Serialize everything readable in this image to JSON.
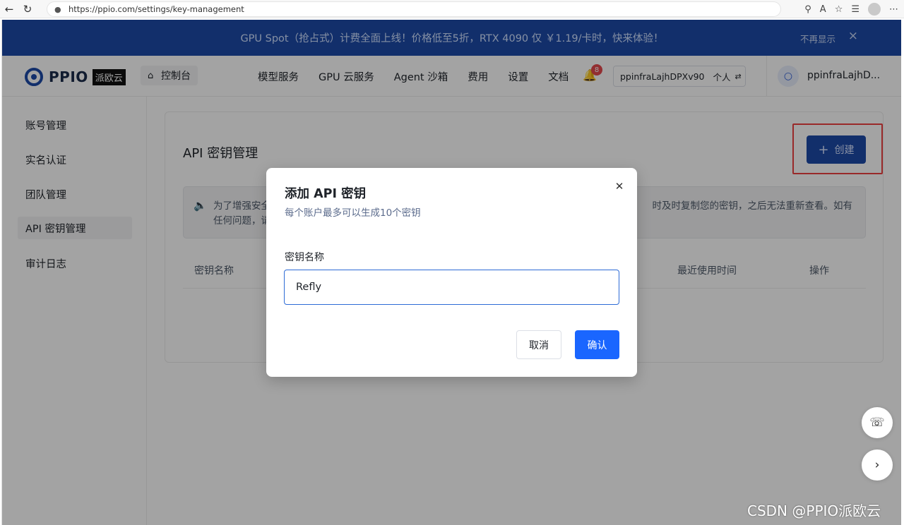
{
  "browser": {
    "url": "https://ppio.com/settings/key-management"
  },
  "promo": {
    "text": "GPU Spot（抢占式）计费全面上线！价格低至5折，RTX 4090 仅 ￥1.19/卡时，快来体验！",
    "dismiss_label": "不再显示",
    "close_icon": "×"
  },
  "header": {
    "logo_text": "PPIO",
    "logo_cn": "派欧云",
    "console_label": "控制台",
    "nav": [
      "模型服务",
      "GPU 云服务",
      "Agent 沙箱",
      "费用",
      "设置",
      "文档"
    ],
    "notification_count": "8",
    "account": {
      "name": "ppinfraLajhDPXv90",
      "type_tag": "个人"
    },
    "user_name": "ppinfraLajhD..."
  },
  "sidebar": {
    "items": [
      {
        "label": "账号管理",
        "active": false
      },
      {
        "label": "实名认证",
        "active": false
      },
      {
        "label": "团队管理",
        "active": false
      },
      {
        "label": "API 密钥管理",
        "active": true
      },
      {
        "label": "审计日志",
        "active": false
      }
    ]
  },
  "page": {
    "title": "API 密钥管理",
    "create_label": "创建",
    "notice": {
      "line1_start": "为了增强安全",
      "line1_end": "时及时复制您的密钥，之后无法重新查看。如有",
      "line2_start": "任何问题，请"
    },
    "table_columns": [
      "密钥名称",
      "最近使用时间",
      "操作"
    ]
  },
  "modal": {
    "title": "添加 API 密钥",
    "subtitle": "每个账户最多可以生成10个密钥",
    "field_label": "密钥名称",
    "field_value": "Refly",
    "cancel_label": "取消",
    "confirm_label": "确认"
  },
  "watermark": "CSDN @PPIO派欧云",
  "colors": {
    "brand": "#1d4aa8",
    "primary_button": "#1a66ff",
    "highlight_border": "#ef4040"
  }
}
